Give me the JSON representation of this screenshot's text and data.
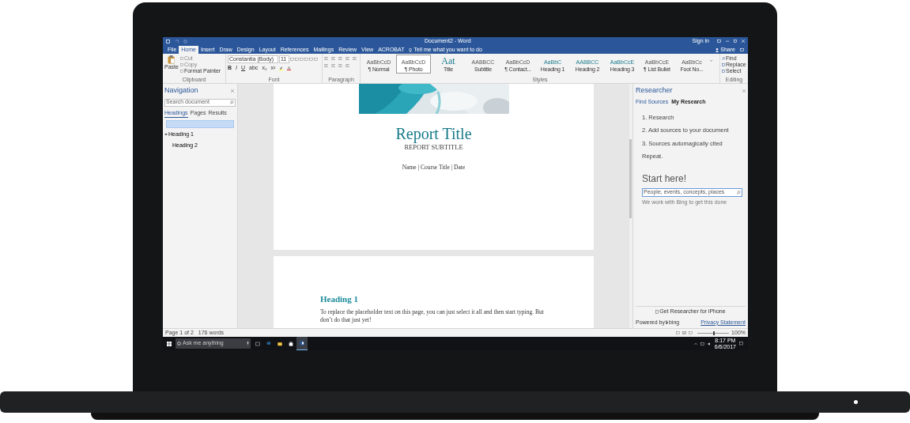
{
  "window": {
    "title": "Document2 - Word",
    "sign_in": "Sign in"
  },
  "ribbon_tabs": [
    {
      "label": "File",
      "selected": false
    },
    {
      "label": "Home",
      "selected": true
    },
    {
      "label": "Insert",
      "selected": false
    },
    {
      "label": "Draw",
      "selected": false
    },
    {
      "label": "Design",
      "selected": false
    },
    {
      "label": "Layout",
      "selected": false
    },
    {
      "label": "References",
      "selected": false
    },
    {
      "label": "Mailings",
      "selected": false
    },
    {
      "label": "Review",
      "selected": false
    },
    {
      "label": "View",
      "selected": false
    },
    {
      "label": "ACROBAT",
      "selected": false
    }
  ],
  "tell_me": "Tell me what you want to do",
  "share": "Share",
  "clipboard": {
    "paste": "Paste",
    "cut": "Cut",
    "copy": "Copy",
    "format_painter": "Format Painter",
    "label": "Clipboard"
  },
  "font": {
    "name": "Constantia (Body)",
    "size": "11",
    "buttons": [
      "B",
      "I",
      "U",
      "abc",
      "x₂",
      "x²"
    ],
    "label": "Font"
  },
  "paragraph": {
    "label": "Paragraph"
  },
  "styles": {
    "label": "Styles",
    "items": [
      {
        "sample": "AaBbCcD",
        "name": "¶ Normal",
        "kind": "plain",
        "selected": false
      },
      {
        "sample": "AaBbCcD",
        "name": "¶ Photo",
        "kind": "plain",
        "selected": true
      },
      {
        "sample": "Aat",
        "name": "Title",
        "kind": "title",
        "selected": false
      },
      {
        "sample": "AABBCC",
        "name": "Subtitle",
        "kind": "plain",
        "selected": false
      },
      {
        "sample": "AaBbCcD",
        "name": "¶ Contact...",
        "kind": "plain",
        "selected": false
      },
      {
        "sample": "AaBbC",
        "name": "Heading 1",
        "kind": "heading",
        "selected": false
      },
      {
        "sample": "AABBCC",
        "name": "Heading 2",
        "kind": "heading",
        "selected": false
      },
      {
        "sample": "AaBbCcE",
        "name": "Heading 3",
        "kind": "heading",
        "selected": false
      },
      {
        "sample": "AaBbCcE",
        "name": "¶ List Bullet",
        "kind": "plain",
        "selected": false
      },
      {
        "sample": "AaBbCc",
        "name": "Foot No...",
        "kind": "plain",
        "selected": false
      }
    ]
  },
  "editing": {
    "label": "Editing",
    "items": [
      "Find",
      "Replace",
      "Select"
    ]
  },
  "navigation": {
    "title": "Navigation",
    "search_placeholder": "Search document",
    "tabs": [
      {
        "label": "Headings",
        "selected": true
      },
      {
        "label": "Pages",
        "selected": false
      },
      {
        "label": "Results",
        "selected": false
      }
    ],
    "headings": [
      {
        "label": "Heading 1",
        "expanded": true,
        "children": [
          {
            "label": "Heading 2"
          }
        ]
      }
    ]
  },
  "cover": {
    "title": "Report Title",
    "subtitle": "REPORT SUBTITLE",
    "byline": "Name | Course Title | Date"
  },
  "page2": {
    "heading": "Heading 1",
    "body": "To replace the placeholder text on this page, you can just select it all and then start typing. But don’t do that just yet!"
  },
  "researcher": {
    "title": "Researcher",
    "tabs": [
      {
        "label": "Find Sources",
        "selected": false
      },
      {
        "label": "My Research",
        "selected": true
      }
    ],
    "steps": [
      "1. Research",
      "2. Add sources to your document",
      "3. Sources automagically cited",
      "Repeat."
    ],
    "start": "Start here!",
    "search_placeholder": "People, events, concepts, places",
    "note": "We work with Bing to get this done",
    "iphone": "Get Researcher for iPhone",
    "powered": "Powered by",
    "bing": "bing",
    "privacy": "Privacy Statement"
  },
  "status_bar": {
    "page": "Page 1 of 2",
    "words": "176 words",
    "zoom": "100%",
    "zoom_slider": {
      "level": 0.5
    }
  },
  "taskbar": {
    "search_placeholder": "Ask me anything",
    "time": "8:17 PM",
    "date": "6/6/2017"
  }
}
